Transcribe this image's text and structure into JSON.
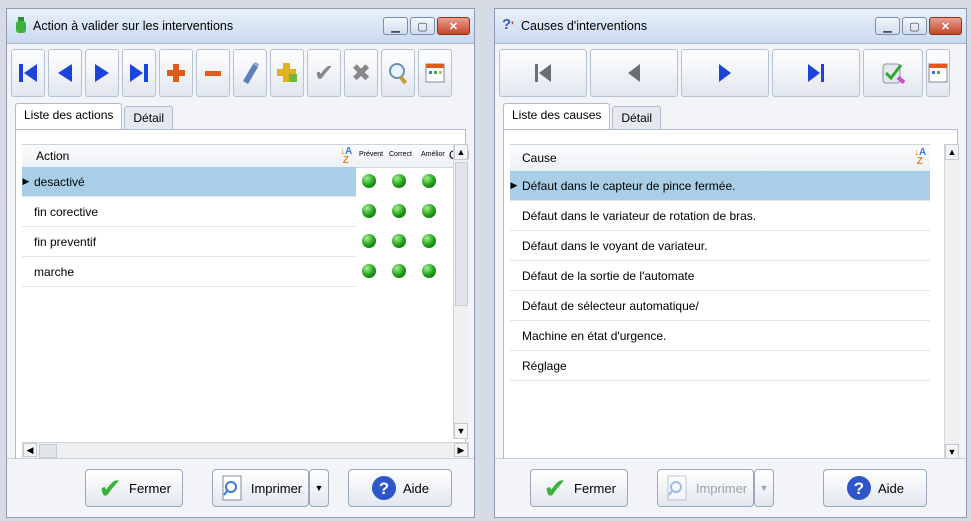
{
  "left_window": {
    "title": "Action à valider sur les interventions",
    "tabs": [
      "Liste des actions",
      "Détail"
    ],
    "columns": {
      "action": "Action",
      "preventif": "Prévent",
      "correctif": "Correct",
      "amelior": "Amélior",
      "ordre": "Ord"
    },
    "rows": [
      {
        "action": "desactivé",
        "preventif": true,
        "correctif": true,
        "amelior": true
      },
      {
        "action": "fin corective",
        "preventif": true,
        "correctif": true,
        "amelior": true
      },
      {
        "action": "fin preventif",
        "preventif": true,
        "correctif": true,
        "amelior": true
      },
      {
        "action": "marche",
        "preventif": true,
        "correctif": true,
        "amelior": true
      }
    ],
    "buttons": {
      "fermer": "Fermer",
      "imprimer": "Imprimer",
      "aide": "Aide"
    }
  },
  "right_window": {
    "title": "Causes d'interventions",
    "tabs": [
      "Liste des causes",
      "Détail"
    ],
    "column": "Cause",
    "rows": [
      "Défaut dans le capteur de pince fermée.",
      "Défaut dans le variateur de rotation de bras.",
      "Défaut dans le voyant de variateur.",
      "Défaut de la sortie de l'automate",
      "Défaut de sélecteur automatique/",
      "Machine en état d'urgence.",
      "Réglage"
    ],
    "buttons": {
      "fermer": "Fermer",
      "imprimer": "Imprimer",
      "aide": "Aide"
    }
  },
  "colors": {
    "selection": "#a9cfe8",
    "nav_blue": "#1b45d8",
    "green": "#1e9b16"
  }
}
